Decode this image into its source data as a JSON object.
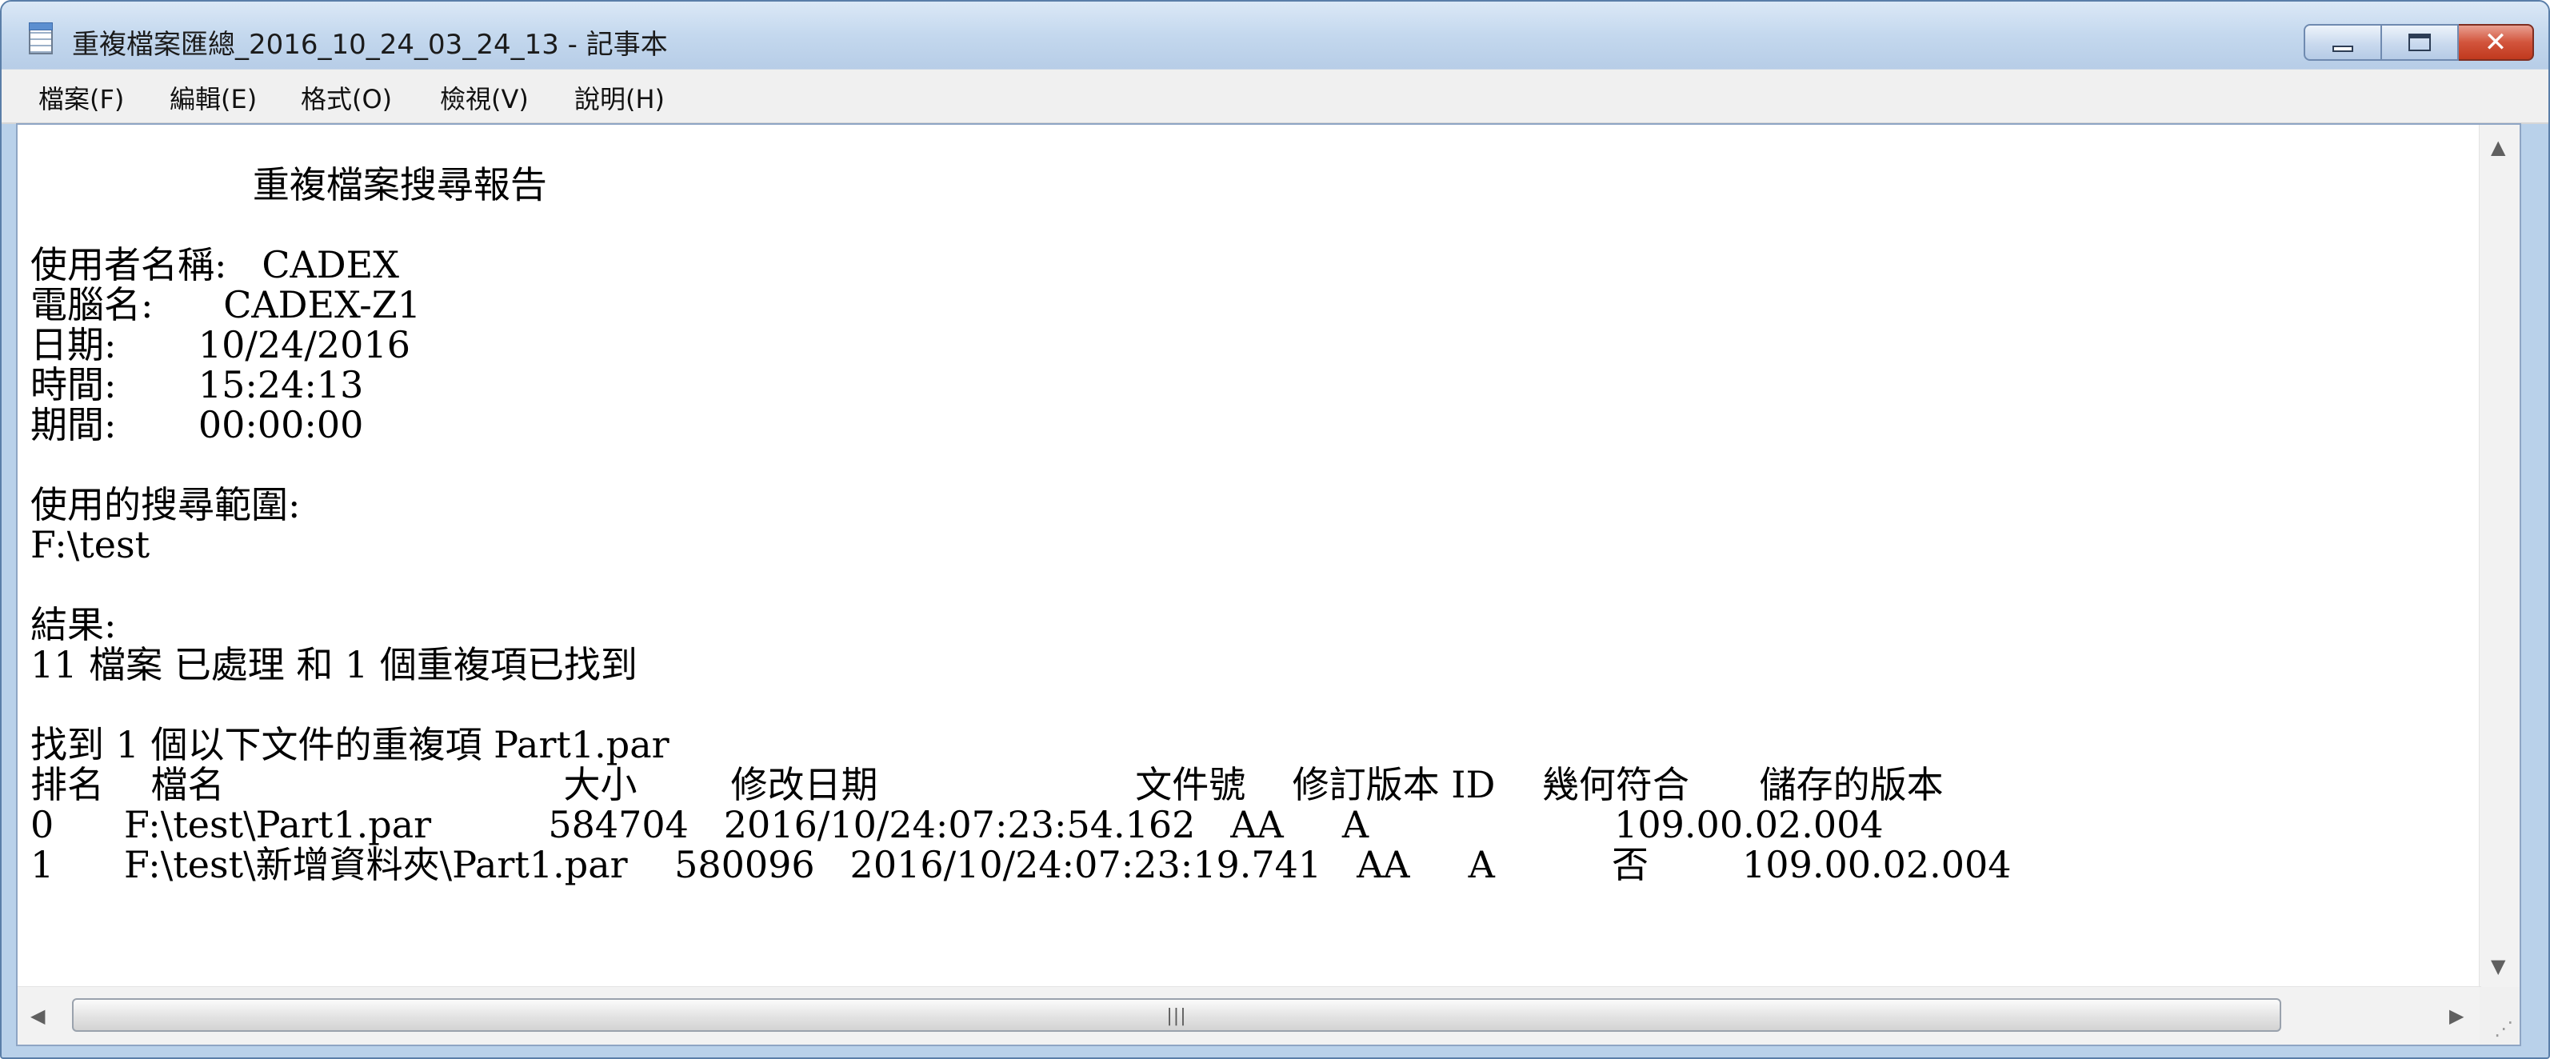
{
  "window": {
    "title": "重複檔案匯總_2016_10_24_03_24_13 - 記事本",
    "icon": "notepad-icon"
  },
  "caption_buttons": {
    "minimize_icon": "minimize-icon",
    "maximize_icon": "maximize-icon",
    "close_icon": "close-icon",
    "close_glyph": "✕"
  },
  "menu": {
    "file": "檔案(F)",
    "edit": "編輯(E)",
    "format": "格式(O)",
    "view": "檢視(V)",
    "help": "說明(H)"
  },
  "document": {
    "lines": [
      "                   重複檔案搜尋報告",
      "",
      "使用者名稱:   CADEX",
      "電腦名:      CADEX-Z1",
      "日期:       10/24/2016",
      "時間:       15:24:13",
      "期間:       00:00:00",
      "",
      "使用的搜尋範圍:",
      "F:\\test",
      "",
      "結果:",
      "11 檔案 已處理 和 1 個重複項已找到",
      "",
      "找到 1 個以下文件的重複項 Part1.par",
      "排名    檔名                             大小        修改日期                      文件號    修訂版本 ID    幾何符合      儲存的版本",
      "0      F:\\test\\Part1.par          584704   2016/10/24:07:23:54.162   AA     A                     109.00.02.004",
      "1      F:\\test\\新增資料夾\\Part1.par    580096   2016/10/24:07:23:19.741   AA     A          否        109.00.02.004"
    ]
  },
  "scrollbars": {
    "up_arrow": "▲",
    "down_arrow": "▼",
    "left_arrow": "◀",
    "right_arrow": "▶",
    "thumb_grip": "|||",
    "resize_grip": "⋰"
  }
}
